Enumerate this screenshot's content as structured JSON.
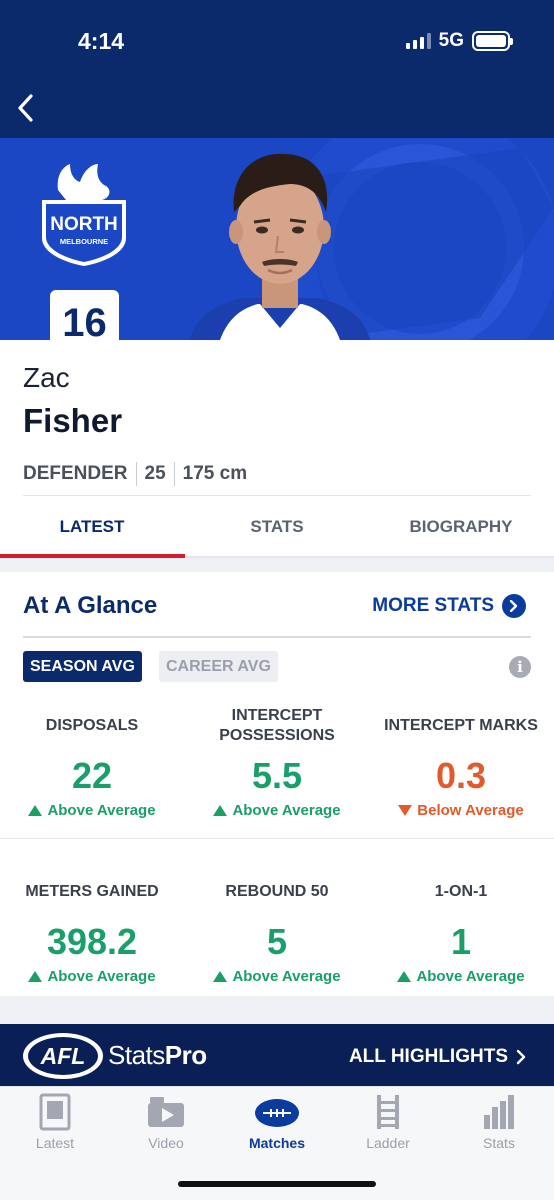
{
  "status_bar": {
    "time": "4:14",
    "network": "5G"
  },
  "hero": {
    "club_name": "NORTH",
    "club_subname": "MELBOURNE",
    "jersey_number": "16"
  },
  "player": {
    "first_name": "Zac",
    "last_name": "Fisher",
    "position": "DEFENDER",
    "age": "25",
    "height": "175 cm"
  },
  "tabs": [
    {
      "label": "LATEST",
      "active": true
    },
    {
      "label": "STATS",
      "active": false
    },
    {
      "label": "BIOGRAPHY",
      "active": false
    }
  ],
  "glance": {
    "title": "At A Glance",
    "more_stats_label": "MORE STATS",
    "season_avg_label": "SEASON AVG",
    "career_avg_label": "CAREER AVG",
    "info_icon": "i",
    "stats": [
      {
        "label": "DISPOSALS",
        "value": "22",
        "trend": "Above Average",
        "direction": "up"
      },
      {
        "label": "INTERCEPT POSSESSIONS",
        "value": "5.5",
        "trend": "Above Average",
        "direction": "up"
      },
      {
        "label": "INTERCEPT MARKS",
        "value": "0.3",
        "trend": "Below Average",
        "direction": "down"
      },
      {
        "label": "METERS GAINED",
        "value": "398.2",
        "trend": "Above Average",
        "direction": "up"
      },
      {
        "label": "REBOUND 50",
        "value": "5",
        "trend": "Above Average",
        "direction": "up"
      },
      {
        "label": "1-ON-1",
        "value": "1",
        "trend": "Above Average",
        "direction": "up"
      }
    ]
  },
  "promo": {
    "brand": "AFL",
    "product_light": "Stats",
    "product_bold": "Pro",
    "cta": "ALL HIGHLIGHTS"
  },
  "bottom_nav": [
    {
      "label": "Latest",
      "icon": "latest-icon"
    },
    {
      "label": "Video",
      "icon": "video-icon"
    },
    {
      "label": "Matches",
      "icon": "football-icon",
      "active": true
    },
    {
      "label": "Ladder",
      "icon": "ladder-icon"
    },
    {
      "label": "Stats",
      "icon": "bar-chart-icon"
    }
  ],
  "colors": {
    "navy": "#0b2a6b",
    "royal": "#1b47c4",
    "accent_red": "#d11f2f",
    "green": "#1a9e6a",
    "orange": "#e35a2a"
  }
}
